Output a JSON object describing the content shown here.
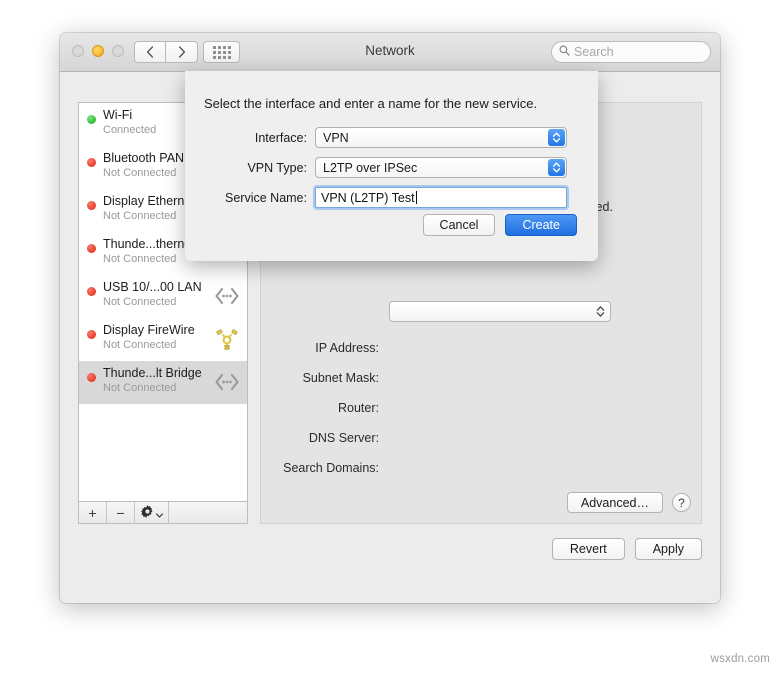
{
  "window": {
    "title": "Network",
    "traffic_lights": [
      "close",
      "minimize",
      "zoom"
    ],
    "nav": {
      "back_icon": "chevron-left-icon",
      "forward_icon": "chevron-right-icon",
      "showall_icon": "grid-dots-icon"
    },
    "search": {
      "placeholder": "Search",
      "icon": "search-icon",
      "value": ""
    }
  },
  "services": [
    {
      "name": "Wi-Fi",
      "status": "Connected",
      "state": "green",
      "icon": "none",
      "selected": false
    },
    {
      "name": "Bluetooth PAN",
      "status": "Not Connected",
      "state": "red",
      "icon": "none",
      "selected": false
    },
    {
      "name": "Display Ethern",
      "status": "Not Connected",
      "state": "red",
      "icon": "none",
      "selected": false
    },
    {
      "name": "Thunde...thernet",
      "status": "Not Connected",
      "state": "red",
      "icon": "ethernet",
      "selected": false
    },
    {
      "name": "USB 10/...00 LAN",
      "status": "Not Connected",
      "state": "red",
      "icon": "ethernet",
      "selected": false
    },
    {
      "name": "Display FireWire",
      "status": "Not Connected",
      "state": "red",
      "icon": "firewire",
      "selected": false
    },
    {
      "name": "Thunde...lt Bridge",
      "status": "Not Connected",
      "state": "red",
      "icon": "ethernet",
      "selected": true
    }
  ],
  "list_toolbar": {
    "add_label": "+",
    "remove_label": "−",
    "action_icon": "gear-icon",
    "action_chevron": "chevron-down-icon"
  },
  "detail": {
    "status_tail_text": "connected.",
    "configure_value": "",
    "rows": [
      {
        "label": "IP Address:",
        "value": ""
      },
      {
        "label": "Subnet Mask:",
        "value": ""
      },
      {
        "label": "Router:",
        "value": ""
      },
      {
        "label": "DNS Server:",
        "value": ""
      },
      {
        "label": "Search Domains:",
        "value": ""
      }
    ],
    "advanced_label": "Advanced…",
    "help_label": "?"
  },
  "footer": {
    "revert_label": "Revert",
    "apply_label": "Apply"
  },
  "sheet": {
    "title": "Select the interface and enter a name for the new service.",
    "interface_label": "Interface:",
    "interface_value": "VPN",
    "vpn_type_label": "VPN Type:",
    "vpn_type_value": "L2TP over IPSec",
    "service_name_label": "Service Name:",
    "service_name_value": "VPN (L2TP) Test",
    "cancel_label": "Cancel",
    "create_label": "Create"
  },
  "watermark": "wsxdn.com",
  "colors": {
    "accent_blue": "#1f6fe0",
    "connected_green": "#2fbd2f",
    "disconnected_red": "#e83b2a",
    "firewire_yellow": "#ddc84a"
  }
}
